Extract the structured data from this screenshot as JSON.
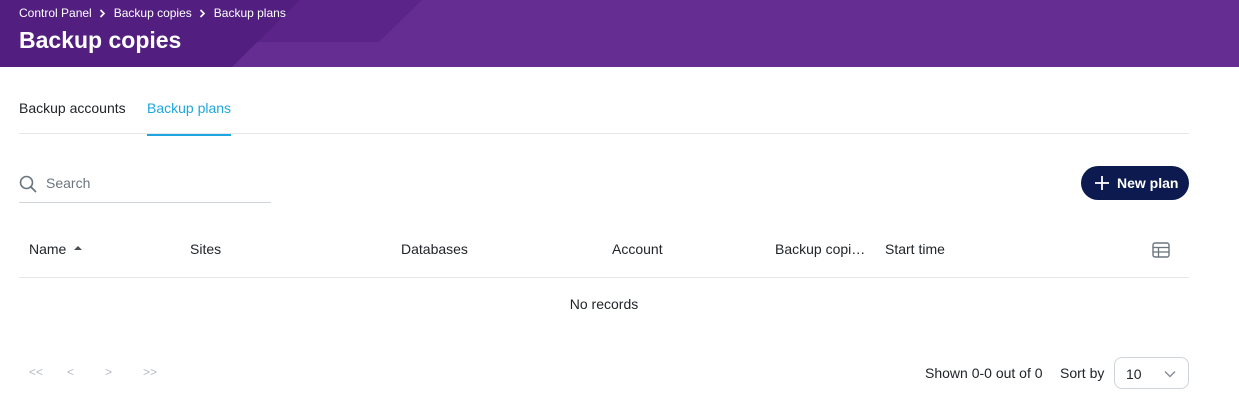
{
  "header": {
    "breadcrumb": [
      "Control Panel",
      "Backup copies",
      "Backup plans"
    ],
    "title": "Backup copies"
  },
  "tabs": [
    {
      "label": "Backup accounts",
      "active": false
    },
    {
      "label": "Backup plans",
      "active": true
    }
  ],
  "search": {
    "placeholder": "Search",
    "value": ""
  },
  "toolbar": {
    "new_plan_label": "New plan"
  },
  "table": {
    "columns": [
      "Name",
      "Sites",
      "Databases",
      "Account",
      "Backup copi…",
      "Start time"
    ],
    "sort_column": "Name",
    "empty_text": "No records"
  },
  "pagination": {
    "first": "<<",
    "prev": "<",
    "next": ">",
    "last": ">>",
    "shown_text": "Shown 0-0 out of 0",
    "sort_by_label": "Sort by",
    "page_size": "10"
  },
  "icons": [
    "search-icon",
    "plus-icon",
    "sort-asc-icon",
    "columns-icon",
    "chevron-down-icon",
    "chevron-right-icon"
  ],
  "colors": {
    "header": "#652d91",
    "accent": "#1fa6e0",
    "button": "#0c1a4f"
  }
}
